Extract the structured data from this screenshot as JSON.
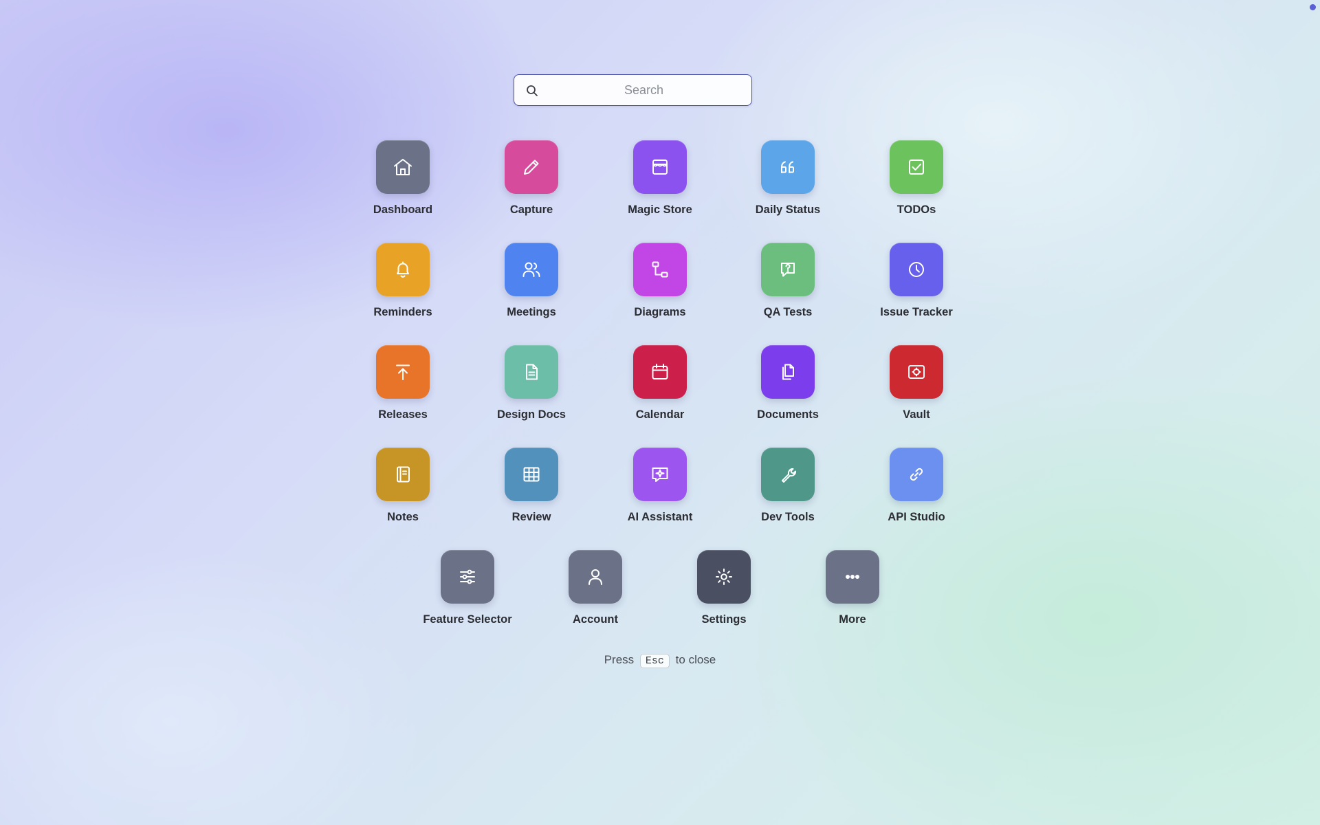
{
  "search": {
    "placeholder": "Search",
    "value": ""
  },
  "apps": [
    {
      "label": "Dashboard",
      "icon": "home-icon",
      "color": "#6b7287"
    },
    {
      "label": "Capture",
      "icon": "pencil-icon",
      "color": "#d64b9c"
    },
    {
      "label": "Magic Store",
      "icon": "store-icon",
      "color": "#8b52f0"
    },
    {
      "label": "Daily Status",
      "icon": "quote-icon",
      "color": "#5ba5e8"
    },
    {
      "label": "TODOs",
      "icon": "checkbox-icon",
      "color": "#6cc35e"
    },
    {
      "label": "Reminders",
      "icon": "bell-icon",
      "color": "#e8a326"
    },
    {
      "label": "Meetings",
      "icon": "users-icon",
      "color": "#4f83f0"
    },
    {
      "label": "Diagrams",
      "icon": "flow-icon",
      "color": "#c146e5"
    },
    {
      "label": "QA Tests",
      "icon": "help-chat-icon",
      "color": "#6cbe7f"
    },
    {
      "label": "Issue Tracker",
      "icon": "clock-icon",
      "color": "#6660ec"
    },
    {
      "label": "Releases",
      "icon": "upload-icon",
      "color": "#e8742a"
    },
    {
      "label": "Design Docs",
      "icon": "document-icon",
      "color": "#6cbea8"
    },
    {
      "label": "Calendar",
      "icon": "calendar-icon",
      "color": "#cc1f4a"
    },
    {
      "label": "Documents",
      "icon": "files-icon",
      "color": "#7c3ded"
    },
    {
      "label": "Vault",
      "icon": "safe-icon",
      "color": "#cc2930"
    },
    {
      "label": "Notes",
      "icon": "notebook-icon",
      "color": "#c69525"
    },
    {
      "label": "Review",
      "icon": "grid-icon",
      "color": "#5291bb"
    },
    {
      "label": "AI Assistant",
      "icon": "ai-chat-icon",
      "color": "#9c55ee"
    },
    {
      "label": "Dev Tools",
      "icon": "wrench-icon",
      "color": "#4f9889"
    },
    {
      "label": "API Studio",
      "icon": "link-icon",
      "color": "#6b90ef"
    },
    {
      "label": "Feature Selector",
      "icon": "sliders-icon",
      "color": "#6b7287"
    },
    {
      "label": "Account",
      "icon": "user-icon",
      "color": "#6b7287"
    },
    {
      "label": "Settings",
      "icon": "sun-gear-icon",
      "color": "#4a4f62"
    },
    {
      "label": "More",
      "icon": "more-icon",
      "color": "#6b7287"
    }
  ],
  "hint": {
    "before": "Press",
    "key": "Esc",
    "after": "to close"
  }
}
